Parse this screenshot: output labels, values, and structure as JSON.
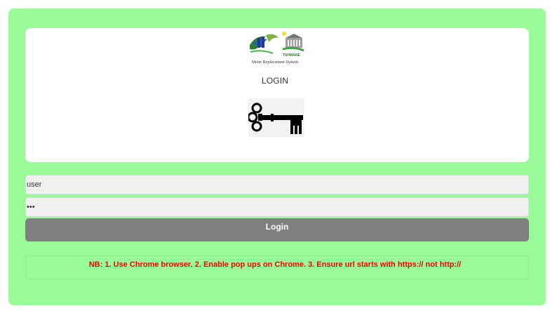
{
  "logo": {
    "emblem_text": "TSHWANE",
    "caption": "Meter Replacement System"
  },
  "login_heading": "LOGIN",
  "form": {
    "username_value": "user",
    "password_value": "•••",
    "login_label": "Login"
  },
  "note": "NB: 1. Use Chrome browser. 2. Enable pop ups on Chrome. 3. Ensure url starts with https:// not http://",
  "colors": {
    "page_bg": "#98fb98",
    "button": "#808080",
    "note_text": "#ee0000"
  }
}
